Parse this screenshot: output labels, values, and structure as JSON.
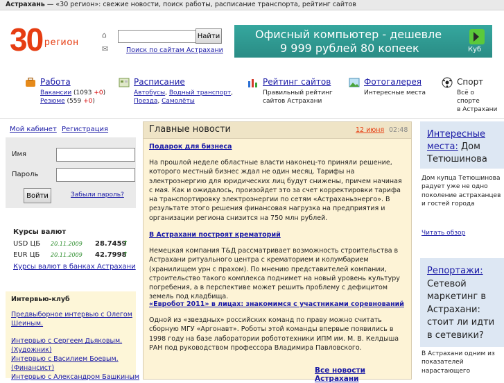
{
  "topbar": {
    "site": "Астрахань",
    "tagline": " — «30 регион»: свежие новости, поиск работы, расписание транспорта, рейтинг сайтов"
  },
  "logo": {
    "number": "30",
    "word": "регион"
  },
  "search": {
    "button": "Найти",
    "value": "",
    "link": "Поиск по сайтам Астрахани"
  },
  "banner": {
    "line1": "Офисный компьютер - дешевле",
    "line2": "9 999 рублей 80 копеек",
    "brand": "Куб"
  },
  "nav": [
    {
      "title": "Работа",
      "sub1_link": "Вакансии",
      "sub1_count": " (1093 ",
      "sub1_delta": "+0",
      "sub1_close": ")",
      "sub2_link": "Резюме",
      "sub2_count": " (559 ",
      "sub2_delta": "+0",
      "sub2_close": ")"
    },
    {
      "title": "Расписание",
      "links": [
        "Автобусы",
        "Водный транспорт",
        "Поезда",
        "Самолёты"
      ]
    },
    {
      "title": "Рейтинг сайтов",
      "desc1": "Правильный рейтинг",
      "desc2": "сайтов Астрахани"
    },
    {
      "title": "Фотогалерея",
      "desc1": "Интересные места"
    },
    {
      "title": "Спорт",
      "desc1": "Всё о",
      "desc2": "спорте",
      "desc3": "в Астрахани"
    }
  ],
  "account": {
    "cabinet": "Мой кабинет",
    "register": "Регистрация",
    "name_label": "Имя",
    "password_label": "Пароль",
    "login_button": "Войти",
    "forgot": "Забыли пароль?"
  },
  "rates": {
    "title": "Курсы валют",
    "items": [
      {
        "cur": "USD ЦБ",
        "date": "20.11.2009",
        "value": "28.7459",
        "arrow": "↑"
      },
      {
        "cur": "EUR ЦБ",
        "date": "20.11.2009",
        "value": "42.7998",
        "arrow": "↑"
      }
    ],
    "link": "Курсы валют в банках Астрахани"
  },
  "interview": {
    "title": "Интервью-клуб",
    "items": [
      "Предвыборное интервью с Олегом Шеиным.",
      "Интервью с Сергеем Дьяковым. (Художник)",
      "Интервью с Василием Боевым. (Финансист)",
      "Интервью с Александром Башкиным"
    ]
  },
  "news": {
    "title": "Главные новости",
    "date": "12 июня",
    "time": "02:48",
    "items": [
      {
        "title": "Подарок для бизнеса",
        "text": "На прошлой неделе областные власти наконец-то приняли решение, которого местный бизнес ждал не один месяц. Тарифы на электроэнергию для юридических лиц будут снижены, причем начиная с мая. Как и ожидалось, произойдет это за счет корректировки тарифа на транспортировку электроэнергии по сетям «Астраханьэнерго». В результате этого решения финансовая нагрузка на предприятия и организации региона снизится на 750 млн рублей."
      },
      {
        "title": "В Астрахани построят крематорий",
        "text": "Немецкая компания Т&Д рассматривает возможность строительства в Астрахани ритуального центра с крематорием и колумбарием (хранилищем урн с прахом). По мнению представителей компании, строительство такого комплекса поднимет на новый уровень культуру погребения, а в перспективе может решить проблему с дефицитом земель под кладбища."
      },
      {
        "title": "«Евробот 2011» в лицах: знакомимся с участниками соревнований",
        "text": "Одной из «звездных» российских команд по праву можно считать сборную МГУ «Аргонавт». Роботы этой команды впервые появились в 1998 году на базе лаборатории робототехники ИПМ им. М. В. Келдыша РАН под руководством профессора Владимира Павловского."
      }
    ],
    "all_link": "Все новости Астрахани"
  },
  "right1": {
    "title_link": "Интересные места:",
    "title_rest": " Дом Тетюшинова",
    "text": "Дом купца Тетюшинова радует уже не одно поколение астраханцев и гостей города",
    "more": "Читать обзор"
  },
  "right2": {
    "title_link": "Репортажи:",
    "title_rest": " Сетевой маркетинг в Астрахани: стоит ли идти в сетевики?",
    "text": "В Астрахани одним из показателей нарастающего"
  }
}
